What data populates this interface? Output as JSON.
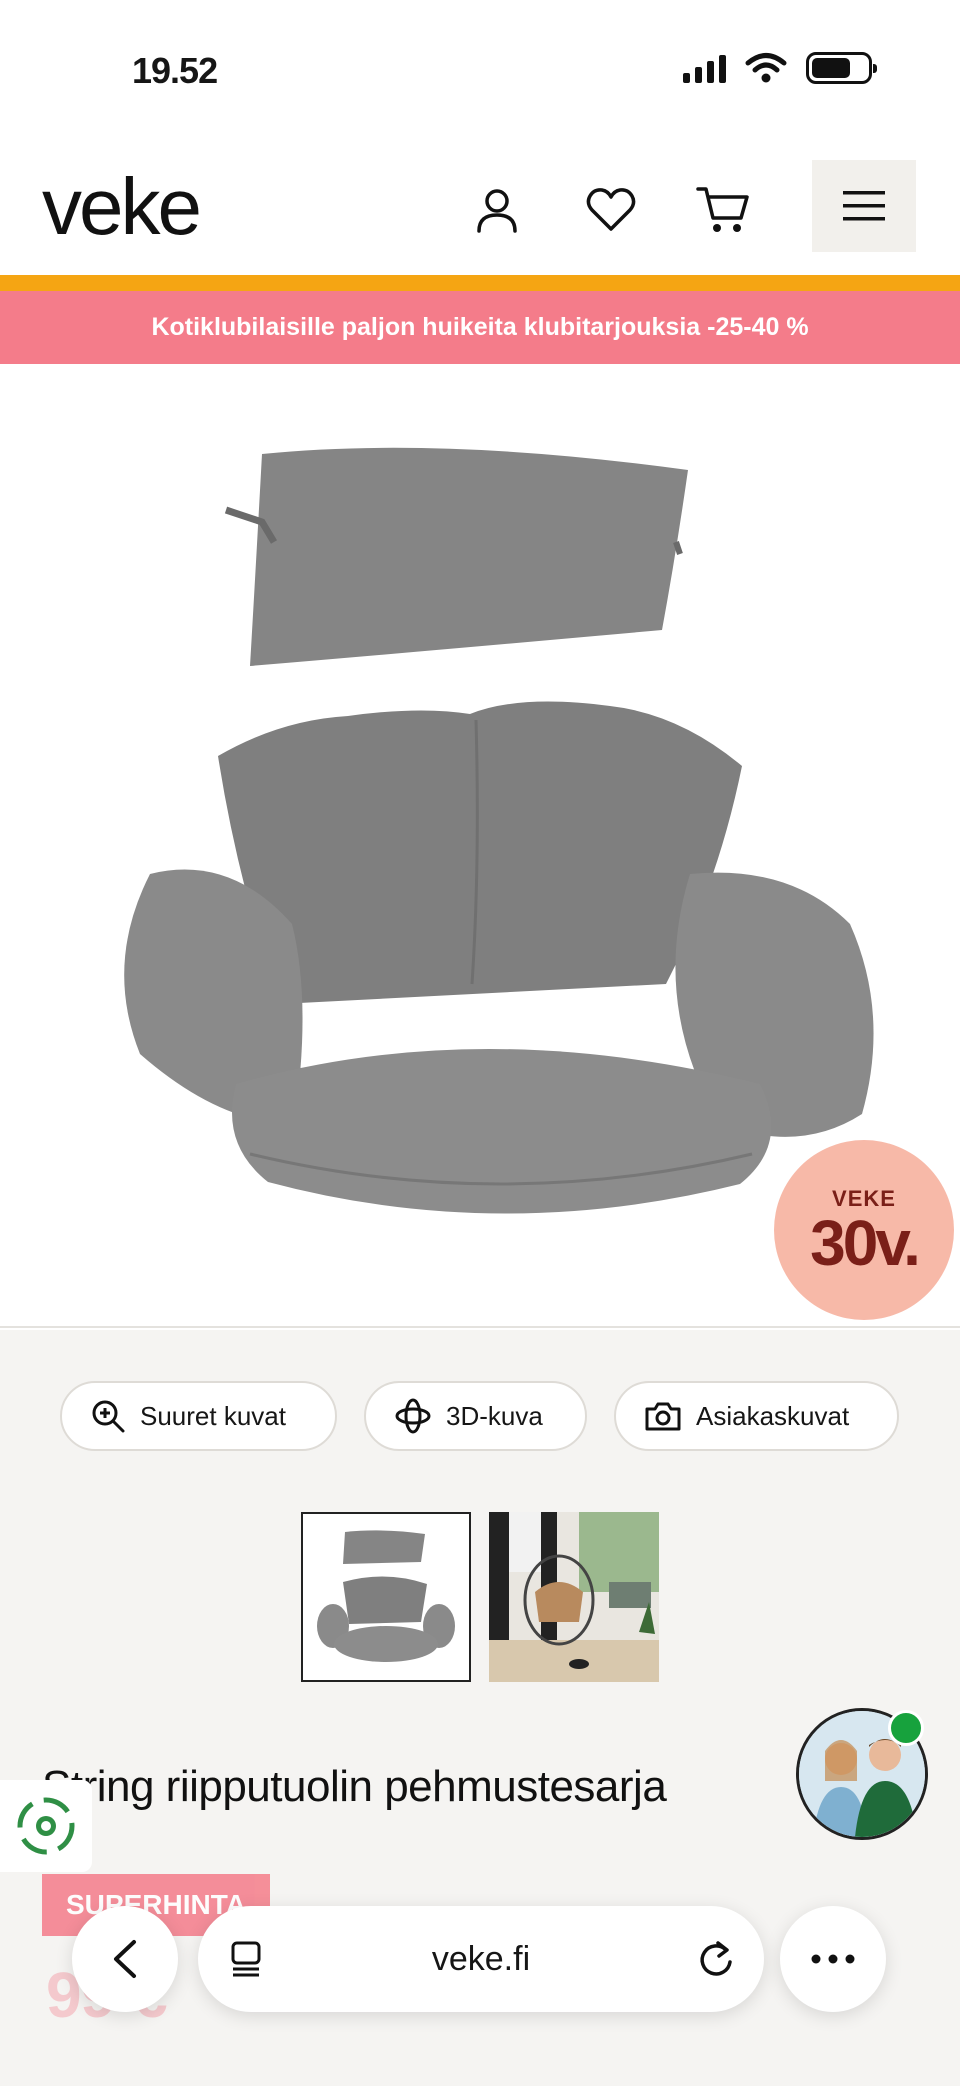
{
  "status_bar": {
    "time": "19.52"
  },
  "header": {
    "logo": "veke",
    "icons": [
      "account-icon",
      "heart-icon",
      "cart-icon",
      "menu-icon"
    ]
  },
  "promo": {
    "text": "Kotiklubilaisille paljon huikeita klubitarjouksia -25-40 %"
  },
  "badge": {
    "line1": "VEKE",
    "line2": "30v."
  },
  "view_buttons": {
    "large_images": "Suuret kuvat",
    "view_3d": "3D-kuva",
    "customer_images": "Asiakaskuvat"
  },
  "product": {
    "title": "String riipputuolin pehmustesarja",
    "label": "SUPERHINTA",
    "price": "99 €"
  },
  "browser": {
    "url": "veke.fi"
  },
  "colors": {
    "promo_pink": "#f47c8a",
    "promo_orange": "#f5a513",
    "badge_peach": "#f7b9a8",
    "badge_text": "#7a1f18",
    "online_green": "#17a23d"
  }
}
